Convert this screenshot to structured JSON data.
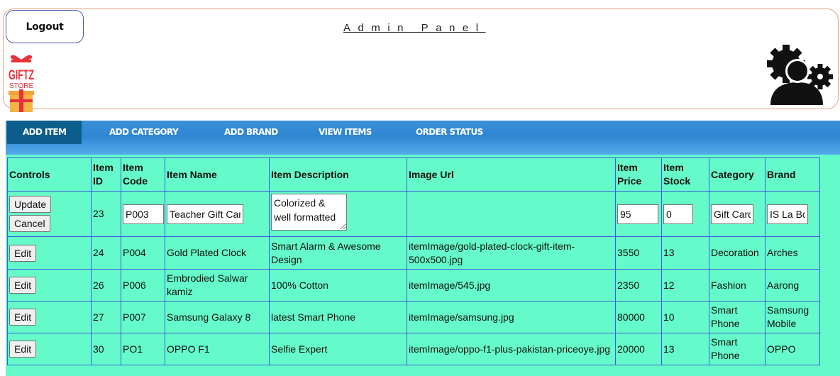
{
  "header": {
    "logout_label": "Logout",
    "title": "Admin Panel",
    "logo_text": "GIFTZ",
    "logo_subtext": "STORE"
  },
  "nav": {
    "items": [
      "ADD ITEM",
      "ADD CATEGORY",
      "ADD BRAND",
      "VIEW ITEMS",
      "ORDER STATUS"
    ],
    "active": "ADD ITEM"
  },
  "table": {
    "headers": {
      "controls": "Controls",
      "item_id": "Item ID",
      "item_code": "Item Code",
      "item_name": "Item Name",
      "item_description": "Item Description",
      "image_url": "Image Url",
      "item_price": "Item Price",
      "item_stock": "Item Stock",
      "category": "Category",
      "brand": "Brand"
    },
    "edit_row": {
      "update_label": "Update",
      "cancel_label": "Cancel",
      "id": "23",
      "code": "P003",
      "name": "Teacher Gift Card",
      "description": "Colorized & well formatted",
      "image_url": "",
      "price": "95",
      "stock": "0",
      "category": "Gift Card",
      "brand": "IS La Boutique"
    },
    "edit_label": "Edit",
    "rows": [
      {
        "id": "24",
        "code": "P004",
        "name": "Gold Plated Clock",
        "description": "Smart Alarm & Awesome Design",
        "image_url": "itemImage/gold-plated-clock-gift-item-500x500.jpg",
        "price": "3550",
        "stock": "13",
        "category": "Decoration",
        "brand": "Arches"
      },
      {
        "id": "26",
        "code": "P006",
        "name": "Embrodied Salwar kamiz",
        "description": "100% Cotton",
        "image_url": "itemImage/545.jpg",
        "price": "2350",
        "stock": "12",
        "category": "Fashion",
        "brand": "Aarong"
      },
      {
        "id": "27",
        "code": "P007",
        "name": "Samsung Galaxy 8",
        "description": "latest Smart Phone",
        "image_url": "itemImage/samsung.jpg",
        "price": "80000",
        "stock": "10",
        "category": "Smart Phone",
        "brand": "Samsung Mobile"
      },
      {
        "id": "30",
        "code": "PO1",
        "name": "OPPO F1",
        "description": "Selfie Expert",
        "image_url": "itemImage/oppo-f1-plus-pakistan-priceoye.jpg",
        "price": "20000",
        "stock": "13",
        "category": "Smart Phone",
        "brand": "OPPO"
      }
    ]
  },
  "colors": {
    "table_bg": "#64fac9",
    "table_border": "#3d5fdb",
    "nav_bg": "#2f86d2",
    "nav_active": "#0d5d8c",
    "header_border": "#e8a078"
  }
}
